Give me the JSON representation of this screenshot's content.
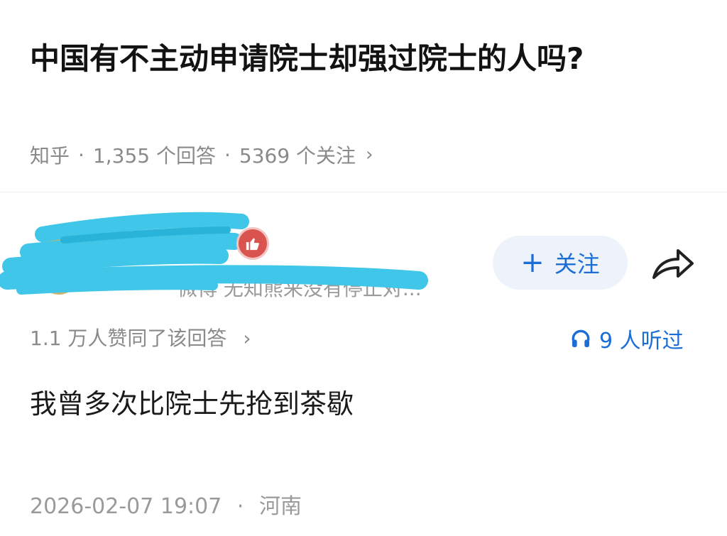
{
  "question": {
    "title": "中国有不主动申请院士却强过院士的人吗?",
    "source": "知乎",
    "answers_count": "1,355 个回答",
    "followers_count": "5369 个关注",
    "separator": "·",
    "chevron": "›"
  },
  "author": {
    "name": "",
    "bio_visible_fragment": "微博 无知熊来没有停止对...",
    "badge_icon": "thumbs-up-icon",
    "follow_label": "关注",
    "follow_icon": "plus-icon",
    "share_icon": "share-icon"
  },
  "answer": {
    "votes_summary": "1.1 万人赞同了该回答",
    "listens": "9 人听过",
    "listen_icon": "headphones-icon",
    "content": "我曾多次比院士先抢到茶歇",
    "timestamp": "2026-02-07 19:07",
    "location": "河南",
    "separator": "·"
  },
  "colors": {
    "accent": "#1b6ed6",
    "redaction": "#3fc6e8",
    "badge": "#d9534f"
  }
}
